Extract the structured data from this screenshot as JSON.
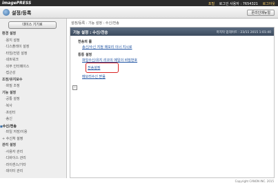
{
  "topbar": {
    "logo": "imagePRESS",
    "links": [
      {
        "label": "포털",
        "highlight": true
      },
      {
        "label": "로그인 사용자 : 7654321",
        "highlight": false
      },
      {
        "label": "로그아웃",
        "highlight": true
      }
    ]
  },
  "titlebar": {
    "title": "설정/등록",
    "manual_button": "온라인매뉴얼"
  },
  "sidebar": {
    "top_button": "대이스 기기로",
    "items": [
      {
        "label": "환경 설정",
        "type": "section"
      },
      {
        "label": "용지 설정",
        "type": "sub"
      },
      {
        "label": "디스플레이 설정",
        "type": "sub"
      },
      {
        "label": "타임/전원 설정",
        "type": "sub"
      },
      {
        "label": "네트워크",
        "type": "sub"
      },
      {
        "label": "외부 인터페이스",
        "type": "sub"
      },
      {
        "label": "접근성",
        "type": "sub"
      },
      {
        "label": "조정/유지보수",
        "type": "section"
      },
      {
        "label": "화질 조정",
        "type": "sub"
      },
      {
        "label": "기능 설정",
        "type": "section"
      },
      {
        "label": "공통 설정",
        "type": "sub"
      },
      {
        "label": "복사",
        "type": "sub"
      },
      {
        "label": "프린터",
        "type": "sub"
      },
      {
        "label": "송신",
        "type": "sub"
      },
      {
        "label": "수신/전송",
        "type": "active"
      },
      {
        "label": "파일 저장/이용",
        "type": "sub"
      },
      {
        "label": "수신처 설정",
        "type": "plus"
      },
      {
        "label": "관리 설정",
        "type": "section"
      },
      {
        "label": "사용자 관리",
        "type": "sub"
      },
      {
        "label": "디바이스 관리",
        "type": "sub"
      },
      {
        "label": "라이센스/기타",
        "type": "sub"
      },
      {
        "label": "데이터 관리",
        "type": "sub"
      }
    ]
  },
  "breadcrumb": "설정/등록 : 기능 설정 : 수신/전송",
  "panel": {
    "title": "기능 설정 : 수신/전송",
    "last_update": "마지막 업데이트 : 23/11 2015 1:01:40",
    "group1_title": "전송의 룰",
    "group1_link": "송신/수신 지정 메모리 이너 지시로",
    "group2_title": "통통 설정",
    "group2_link1": "파일수신/유지 리코의 메일의 비밀번호",
    "group2_link2": "전송설정",
    "group2_link3": "메모리수신 받음",
    "collapse_symbol": "-"
  },
  "footer": "Copyright CANON INC. 2015"
}
